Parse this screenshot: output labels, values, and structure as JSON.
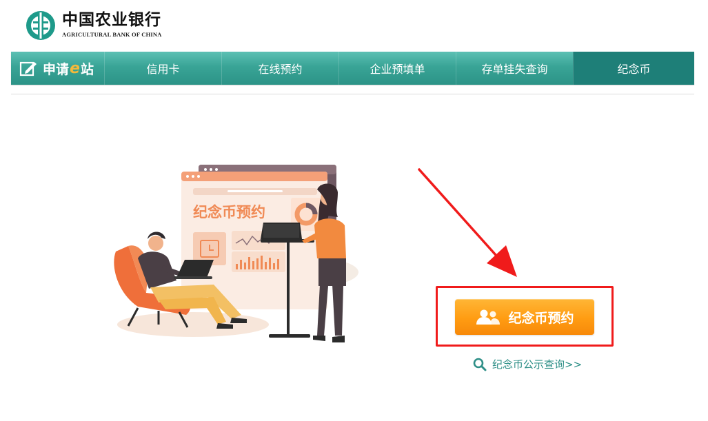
{
  "brand": {
    "name_cn": "中国农业银行",
    "name_en": "AGRICULTURAL BANK OF CHINA",
    "color": "#1e9a8a"
  },
  "nav": {
    "brand_prefix": "申请",
    "brand_e": "e",
    "brand_suffix": "站",
    "items": [
      {
        "label": "信用卡"
      },
      {
        "label": "在线预约"
      },
      {
        "label": "企业预填单"
      },
      {
        "label": "存单挂失查询"
      },
      {
        "label": "纪念币",
        "active": true
      }
    ]
  },
  "illustration": {
    "screen_title": "纪念币预约"
  },
  "main": {
    "appointment_button": "纪念币预约",
    "query_link": "纪念币公示查询>>"
  },
  "colors": {
    "nav_teal": "#39a496",
    "nav_active": "#1e7f78",
    "button_orange": "#ff9c12",
    "highlight_red": "#f01b1b",
    "link_teal": "#2e8f87"
  }
}
